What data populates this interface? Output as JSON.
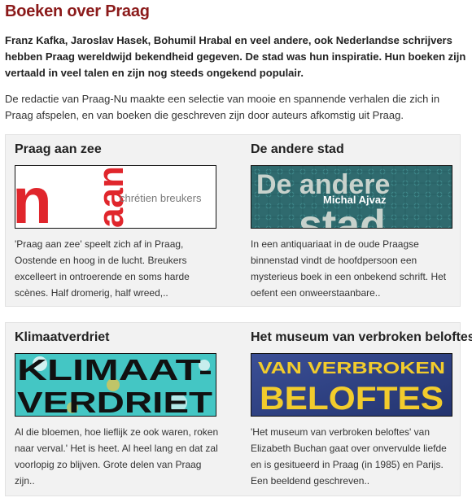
{
  "page": {
    "title": "Boeken over Praag",
    "intro": "Franz Kafka, Jaroslav Hasek, Bohumil Hrabal en veel andere, ook Nederlandse schrijvers hebben Praag wereldwijd bekendheid gegeven. De stad was hun inspiratie. Hun boeken zijn vertaald in veel talen en zijn nog steeds ongekend populair.",
    "description": "De redactie van Praag-Nu maakte een selectie van mooie en spannende verhalen die zich in Praag afspelen, en van boeken die geschreven zijn door auteurs afkomstig uit Praag."
  },
  "books": [
    {
      "title": "Praag aan zee",
      "cover_text": "chrétien breukers",
      "cover_colors": {
        "background": "#ffffff",
        "accent": "#e0262c"
      },
      "excerpt": "'Praag aan zee' speelt zich af in Praag, Oostende en hoog in de lucht. Breukers excelleert in ontroerende en soms harde scènes. Half dromerig, half wreed,.."
    },
    {
      "title": "De andere stad",
      "cover_text_top": "De andere",
      "cover_author": "Michal Ajvaz",
      "cover_text_bottom": "stad",
      "cover_colors": {
        "background": "#2f6a6e",
        "text": "#c8d2cc"
      },
      "excerpt": "In een antiquariaat in de oude Praagse binnenstad vindt de hoofdpersoon een mysterieus boek in een onbekend schrift. Het oefent een onweerstaanbare.."
    },
    {
      "title": "Klimaatverdriet",
      "cover_line1": "KLIMAAT-",
      "cover_line2": "VERDRIET",
      "cover_colors": {
        "background": "#44c6c4",
        "text": "#111111"
      },
      "excerpt": "Al die bloemen, hoe lieflijk ze ook waren, roken naar verval.' Het is heet. Al heel lang en dat zal voorlopig zo blijven. Grote delen van Praag zijn.."
    },
    {
      "title": "Het museum van verbroken beloftes",
      "cover_line1": "VAN VERBROKEN",
      "cover_line2": "BELOFTES",
      "cover_colors": {
        "background": "#2d3f82",
        "text": "#f2cc2c"
      },
      "excerpt": "'Het museum van verbroken beloftes' van Elizabeth Buchan gaat over onvervulde liefde en is gesitueerd in Praag (in 1985) en Parijs. Een beeldend geschreven.."
    }
  ]
}
